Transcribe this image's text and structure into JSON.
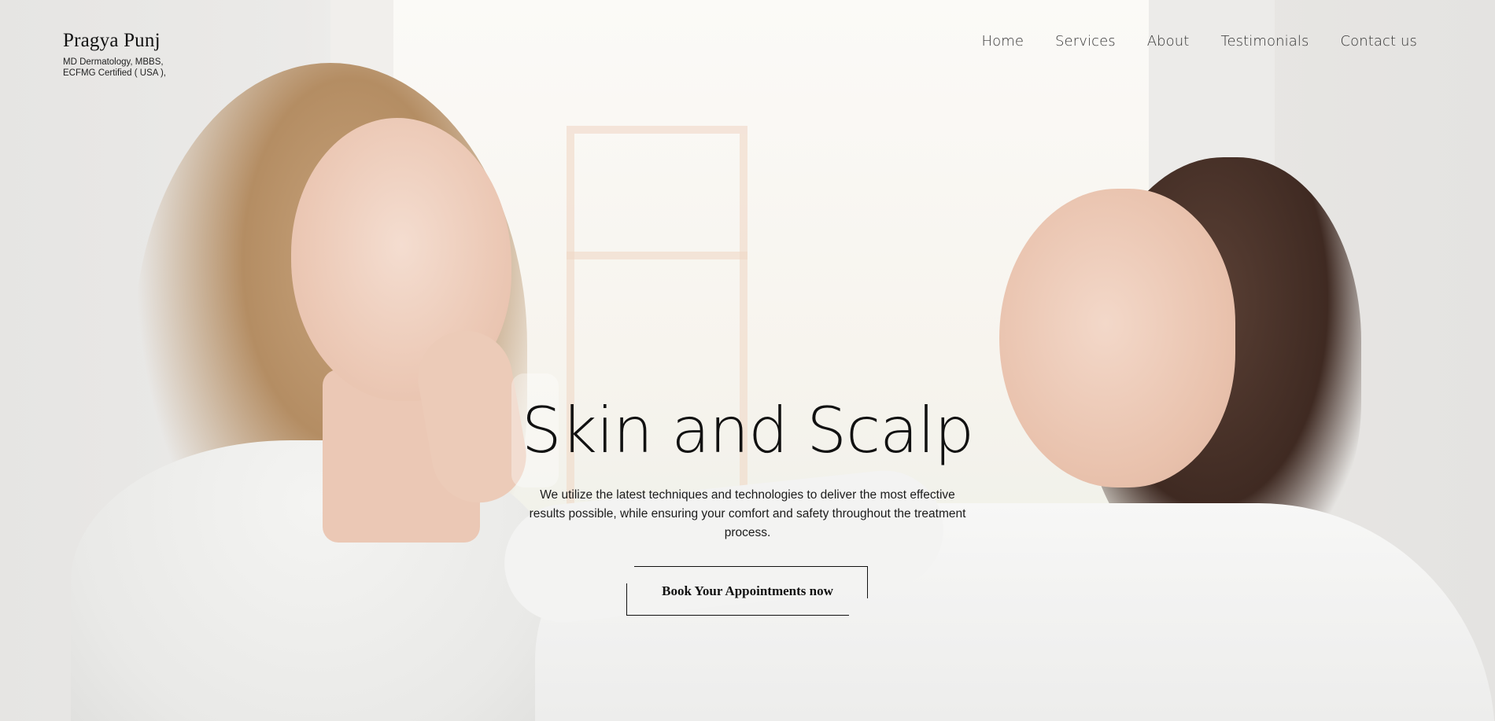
{
  "brand": {
    "name": "Pragya Punj",
    "subtitle_line1": "MD Dermatology, MBBS,",
    "subtitle_line2": "ECFMG Certified ( USA ),"
  },
  "nav": {
    "items": [
      {
        "label": "Home"
      },
      {
        "label": "Services"
      },
      {
        "label": "About"
      },
      {
        "label": "Testimonials"
      },
      {
        "label": "Contact us"
      }
    ]
  },
  "hero": {
    "title": "Skin and Scalp",
    "description": "We utilize the latest techniques and technologies to deliver the most effective results possible, while ensuring your comfort and safety throughout the treatment process.",
    "cta_label": "Book Your Appointments now"
  },
  "colors": {
    "text": "#111111",
    "background": "#e9e8e6"
  }
}
